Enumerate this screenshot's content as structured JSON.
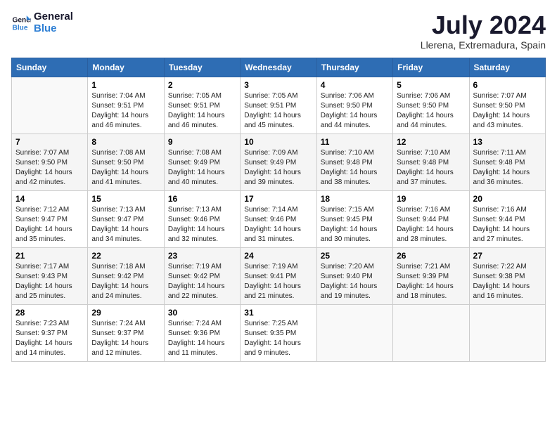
{
  "header": {
    "logo_line1": "General",
    "logo_line2": "Blue",
    "month_year": "July 2024",
    "location": "Llerena, Extremadura, Spain"
  },
  "weekdays": [
    "Sunday",
    "Monday",
    "Tuesday",
    "Wednesday",
    "Thursday",
    "Friday",
    "Saturday"
  ],
  "weeks": [
    [
      {
        "day": "",
        "info": ""
      },
      {
        "day": "1",
        "info": "Sunrise: 7:04 AM\nSunset: 9:51 PM\nDaylight: 14 hours\nand 46 minutes."
      },
      {
        "day": "2",
        "info": "Sunrise: 7:05 AM\nSunset: 9:51 PM\nDaylight: 14 hours\nand 46 minutes."
      },
      {
        "day": "3",
        "info": "Sunrise: 7:05 AM\nSunset: 9:51 PM\nDaylight: 14 hours\nand 45 minutes."
      },
      {
        "day": "4",
        "info": "Sunrise: 7:06 AM\nSunset: 9:50 PM\nDaylight: 14 hours\nand 44 minutes."
      },
      {
        "day": "5",
        "info": "Sunrise: 7:06 AM\nSunset: 9:50 PM\nDaylight: 14 hours\nand 44 minutes."
      },
      {
        "day": "6",
        "info": "Sunrise: 7:07 AM\nSunset: 9:50 PM\nDaylight: 14 hours\nand 43 minutes."
      }
    ],
    [
      {
        "day": "7",
        "info": "Sunrise: 7:07 AM\nSunset: 9:50 PM\nDaylight: 14 hours\nand 42 minutes."
      },
      {
        "day": "8",
        "info": "Sunrise: 7:08 AM\nSunset: 9:50 PM\nDaylight: 14 hours\nand 41 minutes."
      },
      {
        "day": "9",
        "info": "Sunrise: 7:08 AM\nSunset: 9:49 PM\nDaylight: 14 hours\nand 40 minutes."
      },
      {
        "day": "10",
        "info": "Sunrise: 7:09 AM\nSunset: 9:49 PM\nDaylight: 14 hours\nand 39 minutes."
      },
      {
        "day": "11",
        "info": "Sunrise: 7:10 AM\nSunset: 9:48 PM\nDaylight: 14 hours\nand 38 minutes."
      },
      {
        "day": "12",
        "info": "Sunrise: 7:10 AM\nSunset: 9:48 PM\nDaylight: 14 hours\nand 37 minutes."
      },
      {
        "day": "13",
        "info": "Sunrise: 7:11 AM\nSunset: 9:48 PM\nDaylight: 14 hours\nand 36 minutes."
      }
    ],
    [
      {
        "day": "14",
        "info": "Sunrise: 7:12 AM\nSunset: 9:47 PM\nDaylight: 14 hours\nand 35 minutes."
      },
      {
        "day": "15",
        "info": "Sunrise: 7:13 AM\nSunset: 9:47 PM\nDaylight: 14 hours\nand 34 minutes."
      },
      {
        "day": "16",
        "info": "Sunrise: 7:13 AM\nSunset: 9:46 PM\nDaylight: 14 hours\nand 32 minutes."
      },
      {
        "day": "17",
        "info": "Sunrise: 7:14 AM\nSunset: 9:46 PM\nDaylight: 14 hours\nand 31 minutes."
      },
      {
        "day": "18",
        "info": "Sunrise: 7:15 AM\nSunset: 9:45 PM\nDaylight: 14 hours\nand 30 minutes."
      },
      {
        "day": "19",
        "info": "Sunrise: 7:16 AM\nSunset: 9:44 PM\nDaylight: 14 hours\nand 28 minutes."
      },
      {
        "day": "20",
        "info": "Sunrise: 7:16 AM\nSunset: 9:44 PM\nDaylight: 14 hours\nand 27 minutes."
      }
    ],
    [
      {
        "day": "21",
        "info": "Sunrise: 7:17 AM\nSunset: 9:43 PM\nDaylight: 14 hours\nand 25 minutes."
      },
      {
        "day": "22",
        "info": "Sunrise: 7:18 AM\nSunset: 9:42 PM\nDaylight: 14 hours\nand 24 minutes."
      },
      {
        "day": "23",
        "info": "Sunrise: 7:19 AM\nSunset: 9:42 PM\nDaylight: 14 hours\nand 22 minutes."
      },
      {
        "day": "24",
        "info": "Sunrise: 7:19 AM\nSunset: 9:41 PM\nDaylight: 14 hours\nand 21 minutes."
      },
      {
        "day": "25",
        "info": "Sunrise: 7:20 AM\nSunset: 9:40 PM\nDaylight: 14 hours\nand 19 minutes."
      },
      {
        "day": "26",
        "info": "Sunrise: 7:21 AM\nSunset: 9:39 PM\nDaylight: 14 hours\nand 18 minutes."
      },
      {
        "day": "27",
        "info": "Sunrise: 7:22 AM\nSunset: 9:38 PM\nDaylight: 14 hours\nand 16 minutes."
      }
    ],
    [
      {
        "day": "28",
        "info": "Sunrise: 7:23 AM\nSunset: 9:37 PM\nDaylight: 14 hours\nand 14 minutes."
      },
      {
        "day": "29",
        "info": "Sunrise: 7:24 AM\nSunset: 9:37 PM\nDaylight: 14 hours\nand 12 minutes."
      },
      {
        "day": "30",
        "info": "Sunrise: 7:24 AM\nSunset: 9:36 PM\nDaylight: 14 hours\nand 11 minutes."
      },
      {
        "day": "31",
        "info": "Sunrise: 7:25 AM\nSunset: 9:35 PM\nDaylight: 14 hours\nand 9 minutes."
      },
      {
        "day": "",
        "info": ""
      },
      {
        "day": "",
        "info": ""
      },
      {
        "day": "",
        "info": ""
      }
    ]
  ]
}
